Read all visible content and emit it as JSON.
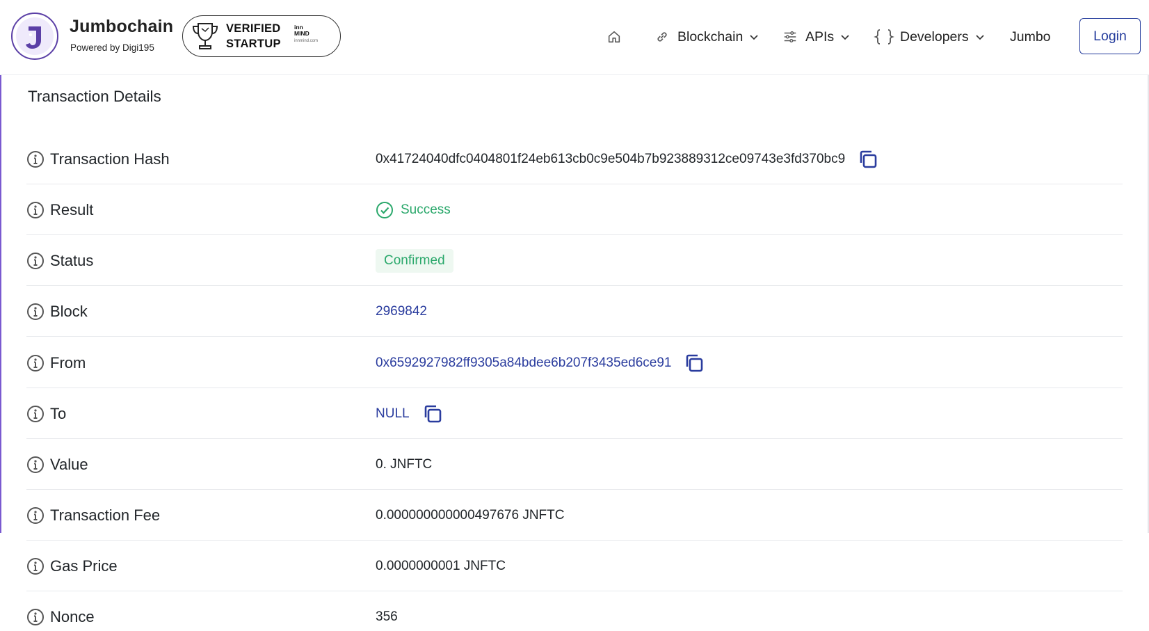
{
  "header": {
    "brand_title": "Jumbochain",
    "brand_subtitle": "Powered by Digi195",
    "badge_line1": "VERIFIED",
    "badge_line2": "STARTUP",
    "badge_partner_line1": "inn",
    "badge_partner_line2": "MIND",
    "badge_partner_url": "innmind.com",
    "nav": {
      "home_icon": "home-icon",
      "blockchain": "Blockchain",
      "apis": "APIs",
      "developers": "Developers",
      "jumbo": "Jumbo",
      "login": "Login"
    }
  },
  "details": {
    "title": "Transaction Details",
    "rows": [
      {
        "label": "Transaction Hash",
        "value": "0x41724040dfc0404801f24eb613cb0c9e504b7b923889312ce09743e3fd370bc9"
      },
      {
        "label": "Result",
        "value": "Success"
      },
      {
        "label": "Status",
        "value": "Confirmed"
      },
      {
        "label": "Block",
        "value": "2969842"
      },
      {
        "label": "From",
        "value": "0x6592927982ff9305a84bdee6b207f3435ed6ce91"
      },
      {
        "label": "To",
        "value": "NULL"
      },
      {
        "label": "Value",
        "value": "0. JNFTC"
      },
      {
        "label": "Transaction Fee",
        "value": "0.000000000000497676 JNFTC"
      },
      {
        "label": "Gas Price",
        "value": "0.0000000001 JNFTC"
      },
      {
        "label": "Nonce",
        "value": "356"
      }
    ]
  },
  "colors": {
    "brand_purple": "#5b3fa6",
    "link_blue": "#2a3c9e",
    "success_green": "#2aa86b",
    "pill_bg": "#eef8f1"
  }
}
